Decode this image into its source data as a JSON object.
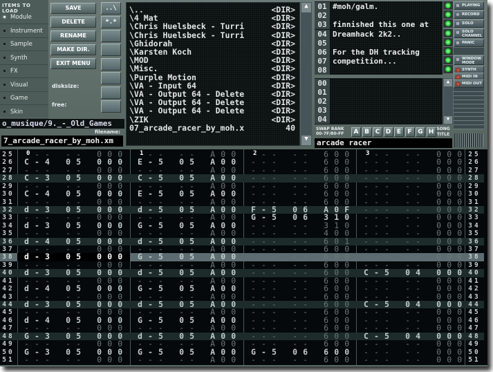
{
  "load_panel": {
    "title": "ITEMS TO LOAD",
    "items": [
      "Module",
      "Instrument",
      "Sample",
      "Synth",
      "FX",
      "Visual",
      "Game",
      "Skin"
    ],
    "selected": "Module"
  },
  "buttons": {
    "save": "SAVE",
    "delete": "DELETE",
    "rename": "RENAME",
    "make_dir": "MAKE DIR.",
    "exit_menu": "EXIT MENU"
  },
  "disk": {
    "disksize_label": "disksize:",
    "free_label": "free:"
  },
  "small_buttons": {
    "parent": "..\\",
    "all": "*.*"
  },
  "path": "o_musique/9._-_Old_Games",
  "filename_label": "filename:",
  "filename": "7_arcade_racer_by_moh.xm",
  "files": [
    {
      "name": "\\..",
      "size": "<DIR>"
    },
    {
      "name": "\\4 Mat",
      "size": "<DIR>"
    },
    {
      "name": "\\Chris Huelsbeck - Turri",
      "size": "<DIR>"
    },
    {
      "name": "\\Chris Huelsbeck - Turri",
      "size": "<DIR>"
    },
    {
      "name": "\\Ghidorah",
      "size": "<DIR>"
    },
    {
      "name": "\\Karsten Koch",
      "size": "<DIR>"
    },
    {
      "name": "\\MOD",
      "size": "<DIR>"
    },
    {
      "name": "\\Misc.",
      "size": "<DIR>"
    },
    {
      "name": "\\Purple Motion",
      "size": "<DIR>"
    },
    {
      "name": "\\VA - Input 64",
      "size": "<DIR>"
    },
    {
      "name": "\\VA - Output 64 - Delete",
      "size": "<DIR>"
    },
    {
      "name": "\\VA - Output 64 - Delete",
      "size": "<DIR>"
    },
    {
      "name": "\\VA - Output 64 - Delete",
      "size": "<DIR>"
    },
    {
      "name": "\\ZIK",
      "size": "<DIR>"
    },
    {
      "name": "07_arcade_racer_by_moh.x",
      "size": "40"
    }
  ],
  "message": [
    {
      "n": "01",
      "t": "#moh/galm."
    },
    {
      "n": "02",
      "t": ""
    },
    {
      "n": "03",
      "t": "finnished this one at"
    },
    {
      "n": "04",
      "t": "Dreamhack 2k2.."
    },
    {
      "n": "05",
      "t": ""
    },
    {
      "n": "06",
      "t": "For the DH tracking"
    },
    {
      "n": "07",
      "t": "competition..."
    },
    {
      "n": "08",
      "t": ""
    }
  ],
  "instruments": [
    "00",
    "01",
    "02",
    "03",
    "04"
  ],
  "side_buttons": {
    "playing": "PLAYING",
    "record": "RECORD",
    "solo": "SOLO",
    "solo_channel": "SOLO CHANNEL",
    "panic": "PANIC",
    "window_mode": "WINDOW MODE",
    "synth": "SYNTH",
    "midi_in": "MIDI IN",
    "midi_out": "MIDI OUT"
  },
  "swap_bank": {
    "label": "SWAP BANK",
    "range": "00-7F/80-FF",
    "banks": [
      "A",
      "B",
      "C",
      "D",
      "E",
      "F",
      "G",
      "H"
    ]
  },
  "song_title_label": "SONG TITLE",
  "song_title": "arcade racer",
  "colors": {
    "led": "#22cc33",
    "background": "#5b6b6b",
    "pattern_bg": "#05090b"
  },
  "pattern": {
    "current_row": "38",
    "channels": [
      "0",
      "1",
      "2",
      "3"
    ],
    "row_numbers": [
      "25",
      "26",
      "27",
      "28",
      "29",
      "30",
      "31",
      "32",
      "33",
      "34",
      "35",
      "36",
      "37",
      "38",
      "39",
      "40",
      "41",
      "42",
      "43",
      "44",
      "45",
      "46",
      "47",
      "48",
      "49",
      "50",
      "51"
    ],
    "data": [
      [
        "--- -- 000",
        "C-4 05 000",
        "--- -- 000",
        "C-3 05 000",
        "--- -- 000",
        "C-4 05 000",
        "--- -- 000",
        "d-3 05 000",
        "--- -- 000",
        "d-3 05 000",
        "--- -- 000",
        "d-4 05 000",
        "--- -- 000",
        "d-3 05 000",
        "--- -- 000",
        "d-3 05 000",
        "--- -- 000",
        "d-4 05 000",
        "--- -- 000",
        "d-3 05 000",
        "--- -- 000",
        "d-4 05 000",
        "--- -- 000",
        "G-3 05 000",
        "--- -- 000",
        "G-3 05 000",
        "--- -- 000"
      ],
      [
        "--- -- A00",
        "E-5 05 A00",
        "--- -- A00",
        "C-5 05 A00",
        "--- -- A00",
        "E-5 05 A00",
        "--- -- A00",
        "d-5 05 A00",
        "--- -- A00",
        "G-5 05 A00",
        "--- -- A00",
        "d-5 05 A00",
        "--- -- A00",
        "G-5 05 A00",
        "--- -- A00",
        "d-5 05 A00",
        "--- -- A00",
        "G-5 05 A00",
        "--- -- A00",
        "d-5 05 A00",
        "--- -- A00",
        "G-5 05 A00",
        "--- -- A00",
        "d-5 05 A00",
        "--- -- A00",
        "G-5 05 A00",
        "--- -- A00"
      ],
      [
        "--- -- 600",
        "--- -- 600",
        "--- -- 600",
        "--- -- 600",
        "--- -- 600",
        "--- -- 600",
        "--- -- 600",
        "F-5 06 A0F",
        "G-5 06 310",
        "--- -- 310",
        "--- -- 400",
        "--- -- 601",
        "--- -- 600",
        "--- -- 600",
        "--- -- 600",
        "--- -- 600",
        "--- -- 600",
        "--- -- 600",
        "--- -- 600",
        "--- -- 600",
        "--- -- 600",
        "--- -- 600",
        "--- -- 600",
        "--- -- 600",
        "--- -- 600",
        "G-5 06 600",
        "--- -- 600"
      ],
      [
        "--- -- 000",
        "--- -- 000",
        "--- -- 000",
        "--- -- 000",
        "--- -- 000",
        "--- -- 000",
        "--- -- 000",
        "--- -- 000",
        "--- -- 000",
        "--- -- 000",
        "--- -- 000",
        "--- -- 000",
        "--- -- 000",
        "--- -- 000",
        "--- -- 000",
        "C-5 04 000",
        "--- -- 000",
        "--- -- 000",
        "--- -- 000",
        "C-5 04 000",
        "--- -- 000",
        "--- -- 000",
        "--- -- 000",
        "C-5 04 000",
        "--- -- 000",
        "--- -- 000",
        "--- -- 000"
      ]
    ]
  }
}
